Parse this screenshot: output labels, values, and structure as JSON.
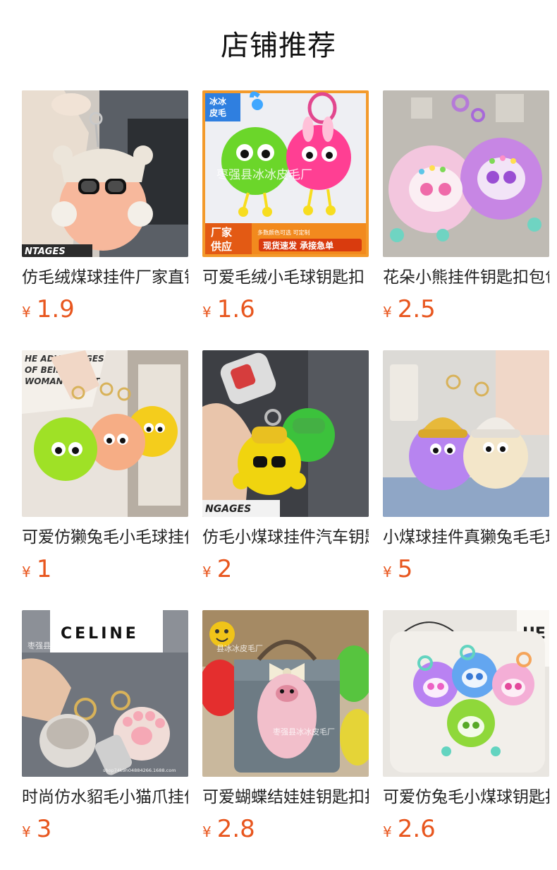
{
  "page": {
    "title": "店铺推荐"
  },
  "products": [
    {
      "name": "仿毛绒煤球挂件厂家直销",
      "currency": "¥",
      "price": "1.9",
      "image": "peach-fluffball-sunglasses-keychain"
    },
    {
      "name": "可爱毛绒小毛球钥匙扣",
      "currency": "¥",
      "price": "1.6",
      "image": "green-and-pink-fluffballs",
      "overlay": {
        "corner_tag": "冰冰\n皮毛",
        "watermark": "枣强县冰冰皮毛厂",
        "promo_left": "厂家\n供应",
        "promo_small": "多数颜色可选  可定制",
        "promo_main": "现货速发 承接急单"
      }
    },
    {
      "name": "花朵小熊挂件钥匙扣包包",
      "currency": "¥",
      "price": "2.5",
      "image": "pink-and-purple-flower-bears"
    },
    {
      "name": "可爱仿獭兔毛小毛球挂件",
      "currency": "¥",
      "price": "1",
      "image": "three-color-fluffballs-in-hand"
    },
    {
      "name": "仿毛小煤球挂件汽车钥匙扣",
      "currency": "¥",
      "price": "2",
      "image": "yellow-and-green-fluffballs-car-key"
    },
    {
      "name": "小煤球挂件真獭兔毛毛球",
      "currency": "¥",
      "price": "5",
      "image": "purple-and-cream-fluffballs-with-hats"
    },
    {
      "name": "时尚仿水貂毛小猫爪挂件",
      "currency": "¥",
      "price": "3",
      "image": "mink-cat-paw-keychains",
      "overlay": {
        "watermark": "枣强县冰冰皮毛厂",
        "footer": "shop74k9h04884266.1688.com"
      }
    },
    {
      "name": "可爱蝴蝶结娃娃钥匙扣挂件",
      "currency": "¥",
      "price": "2.8",
      "image": "pink-long-hair-doll-with-bow",
      "overlay": {
        "watermark": "枣强县冰冰皮毛厂"
      }
    },
    {
      "name": "可爱仿兔毛小煤球钥匙扣",
      "currency": "¥",
      "price": "2.6",
      "image": "colorful-fluffballs-flower-eyes"
    }
  ],
  "colors": {
    "price": "#e8561e",
    "text": "#222222",
    "background": "#ffffff"
  }
}
